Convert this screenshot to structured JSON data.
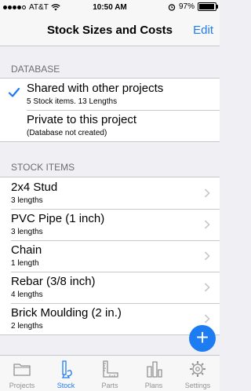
{
  "status_bar": {
    "carrier": "AT&T",
    "time": "10:50 AM",
    "battery": "97%",
    "battery_level": 0.97
  },
  "nav": {
    "title": "Stock Sizes and Costs",
    "edit_label": "Edit"
  },
  "database": {
    "header": "DATABASE",
    "options": [
      {
        "title": "Shared with other projects",
        "subtitle": "5 Stock items. 13 Lengths",
        "selected": true
      },
      {
        "title": "Private to this project",
        "subtitle": "(Database not created)",
        "selected": false
      }
    ]
  },
  "stock": {
    "header": "STOCK ITEMS",
    "items": [
      {
        "title": "2x4 Stud",
        "subtitle": "3 lengths"
      },
      {
        "title": "PVC Pipe (1 inch)",
        "subtitle": "3 lengths"
      },
      {
        "title": "Chain",
        "subtitle": "1 length"
      },
      {
        "title": "Rebar (3/8 inch)",
        "subtitle": "4 lengths"
      },
      {
        "title": "Brick Moulding (2 in.)",
        "subtitle": "2 lengths"
      }
    ]
  },
  "fab_label": "+",
  "tabs": [
    {
      "label": "Projects",
      "icon": "folder-icon",
      "active": false
    },
    {
      "label": "Stock",
      "icon": "stock-icon",
      "active": true
    },
    {
      "label": "Parts",
      "icon": "ruler-icon",
      "active": false
    },
    {
      "label": "Plans",
      "icon": "bar-chart-icon",
      "active": false
    },
    {
      "label": "Settings",
      "icon": "gear-icon",
      "active": false
    }
  ],
  "colors": {
    "accent": "#1e7cf2",
    "background": "#efeff4",
    "inactive_tab": "#929292"
  }
}
